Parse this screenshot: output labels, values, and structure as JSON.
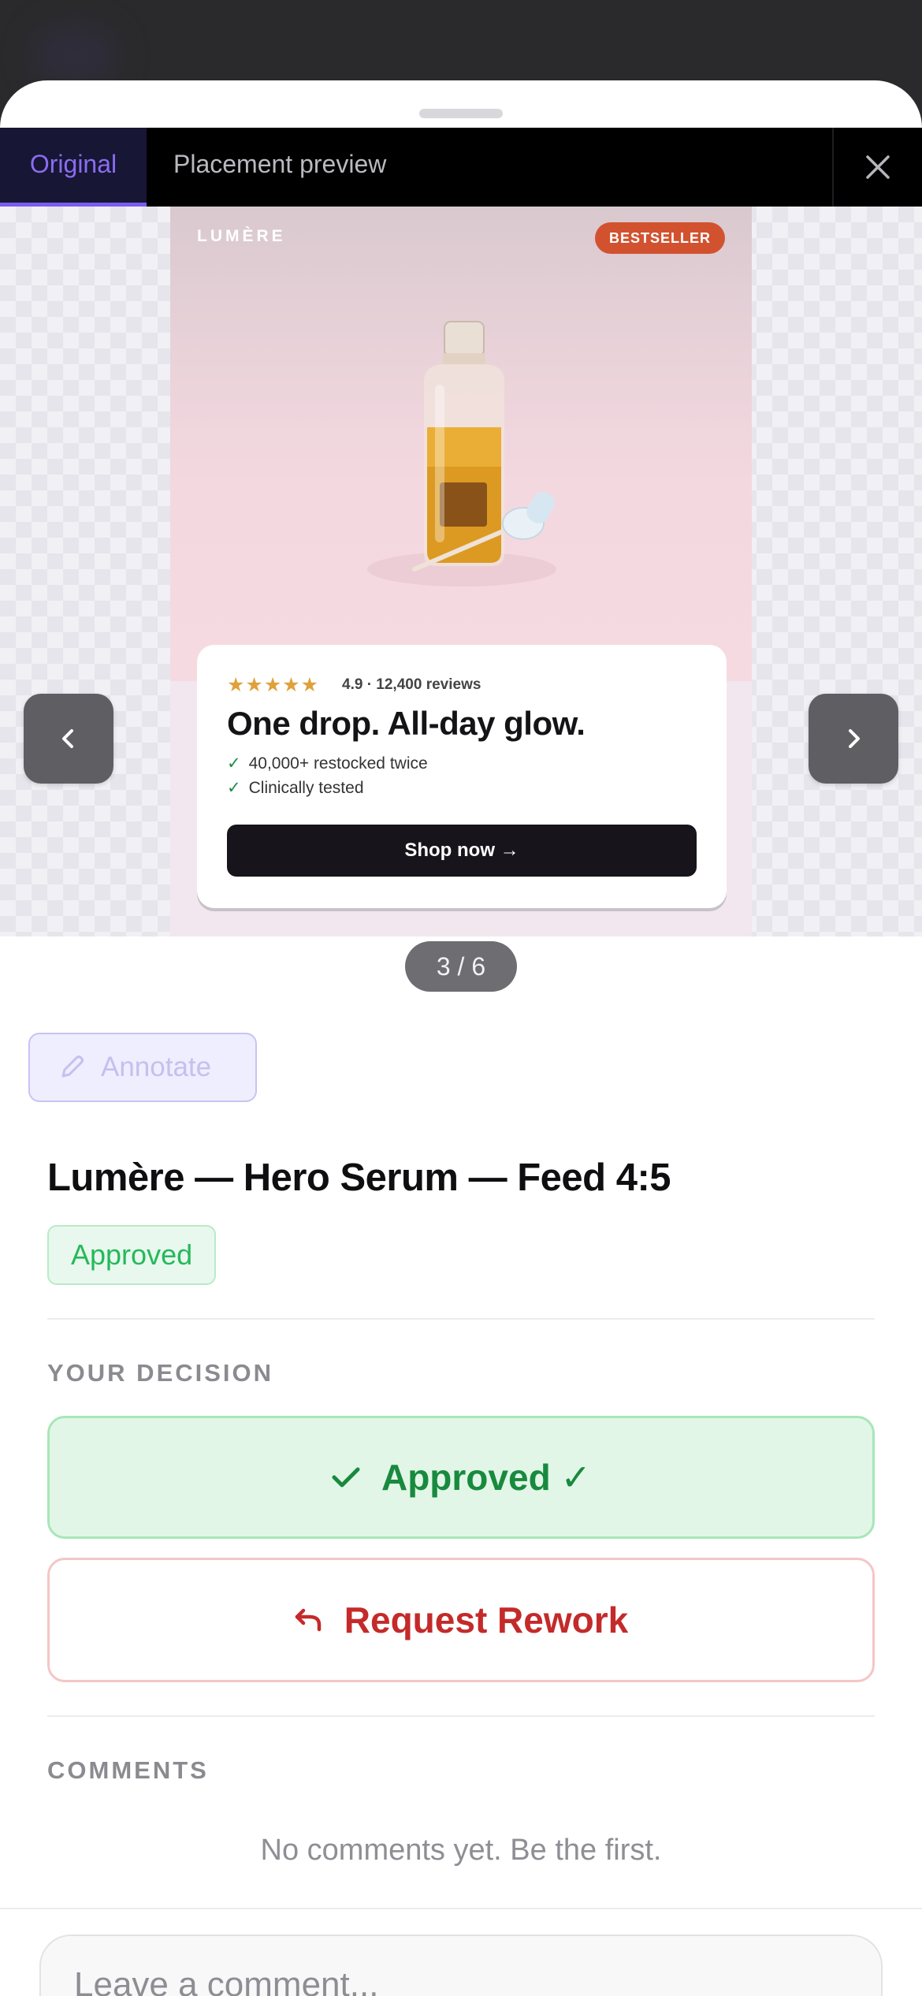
{
  "tabs": {
    "original": "Original",
    "placement": "Placement preview"
  },
  "ad": {
    "brand": "LUMÈRE",
    "badge": "BESTSELLER",
    "stars": "★★★★★",
    "rating": "4.9 · 12,400 reviews",
    "headline": "One drop. All-day glow.",
    "bullets": [
      "40,000+ restocked twice",
      "Clinically tested"
    ],
    "bullet_mark": "✓",
    "cta": "Shop now →"
  },
  "pager": "3 / 6",
  "annotate_label": "Annotate",
  "asset": {
    "title": "Lumère — Hero Serum — Feed 4:5",
    "status": "Approved"
  },
  "decision": {
    "label": "YOUR DECISION",
    "approve": "Approved ✓",
    "rework": "Request Rework"
  },
  "comments": {
    "label": "COMMENTS",
    "empty": "No comments yet. Be the first.",
    "placeholder": "Leave a comment...",
    "value": ""
  },
  "colors": {
    "accent": "#7a5cf0",
    "approved": "#188a3e",
    "rework": "#c42a2a",
    "badge": "#d2522f"
  }
}
